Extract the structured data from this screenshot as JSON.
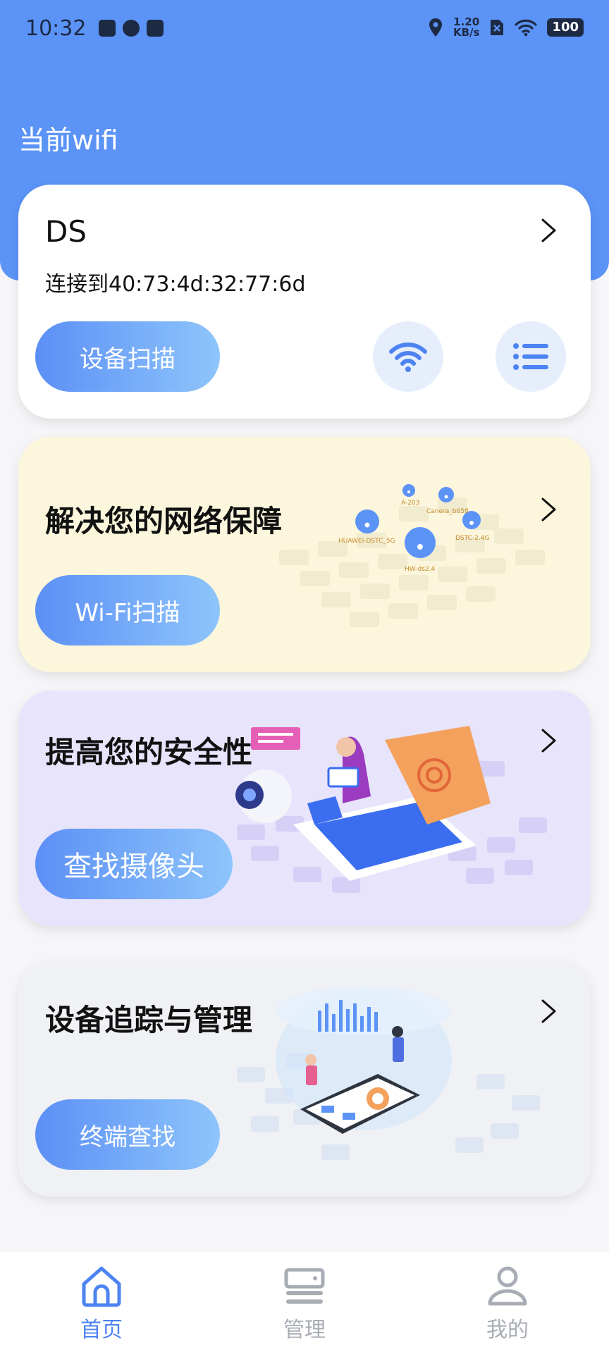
{
  "status_bar": {
    "time": "10:32",
    "net_speed_value": "1.20",
    "net_speed_unit": "KB/s",
    "battery": "100"
  },
  "header": {
    "title": "当前wifi"
  },
  "wifi_card": {
    "ssid": "DS",
    "connection": "连接到40:73:4d:32:77:6d",
    "scan_button": "设备扫描",
    "icons": [
      "wifi-icon",
      "list-icon"
    ]
  },
  "network_card": {
    "title": "解决您的网络保障",
    "button": "Wi-Fi扫描",
    "map_labels": [
      "A-203",
      "Canera_b658",
      "HUAWEI-DSTC_5G",
      "DSTC-2.4G",
      "HW-ds2.4"
    ]
  },
  "security_card": {
    "title": "提高您的安全性",
    "button": "查找摄像头"
  },
  "device_card": {
    "title": "设备追踪与管理",
    "button": "终端查找"
  },
  "tab_bar": {
    "tabs": [
      {
        "label": "首页",
        "icon": "home-icon",
        "active": true
      },
      {
        "label": "管理",
        "icon": "device-icon",
        "active": false
      },
      {
        "label": "我的",
        "icon": "user-icon",
        "active": false
      }
    ]
  },
  "colors": {
    "primary": "#5b93f7",
    "pill_gradient_start": "#5c8ff6",
    "pill_gradient_end": "#8ec5fb",
    "network_card_bg": "#fcf6dc",
    "security_card_bg": "#e7e4fc",
    "device_card_bg": "#f0f1f4",
    "tab_active": "#4d83f2",
    "tab_inactive": "#a8acb4"
  }
}
